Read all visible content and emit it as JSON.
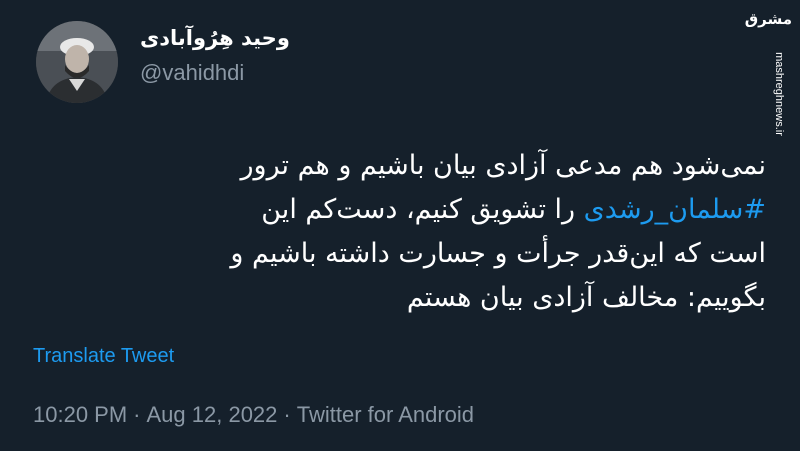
{
  "author": {
    "display_name": "وحید هِرُوآبادی",
    "handle": "@vahidhdi",
    "avatar_icon": "user-avatar-photo"
  },
  "watermark": {
    "logo": "مشرق",
    "url": "mashreghnews.ir"
  },
  "tweet": {
    "line1": "نمی‌شود هم مدعی آزادی بیان باشیم و هم ترور",
    "hashtag": "#سلمان_رشدی",
    "line2_rest": " را تشویق کنیم، دست‌کم این",
    "line3": "است که این‌قدر جرأت و جسارت داشته باشیم و",
    "line4": "بگوییم: مخالف آزادی بیان هستم"
  },
  "translate_label": "Translate Tweet",
  "meta": {
    "time": "10:20 PM",
    "separator": "·",
    "date": "Aug 12, 2022",
    "source": "Twitter for Android"
  },
  "colors": {
    "background": "#15202b",
    "link": "#1d9bf0",
    "secondary_text": "#8b98a5"
  }
}
